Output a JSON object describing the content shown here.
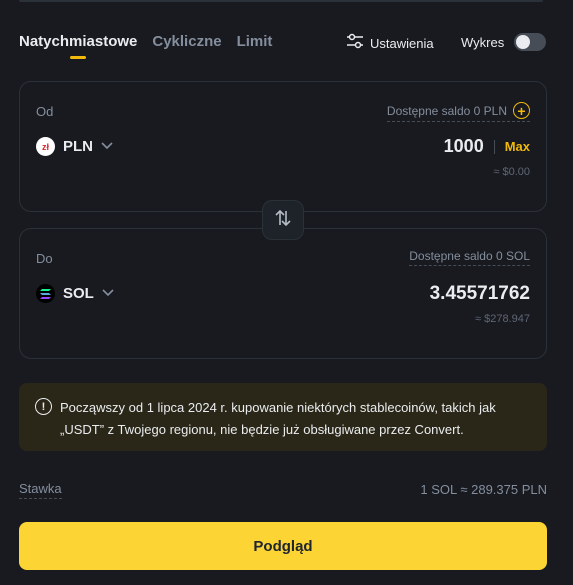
{
  "tabs": [
    {
      "label": "Natychmiastowe",
      "active": true
    },
    {
      "label": "Cykliczne",
      "active": false
    },
    {
      "label": "Limit",
      "active": false
    }
  ],
  "settings_label": "Ustawienia",
  "chart_toggle": {
    "label": "Wykres",
    "on": false
  },
  "from": {
    "label": "Od",
    "balance": "Dostępne saldo 0 PLN",
    "coin": "PLN",
    "coin_glyph": "zł",
    "amount": "1000",
    "max_label": "Max",
    "approx": "≈ $0.00"
  },
  "to": {
    "label": "Do",
    "balance": "Dostępne saldo 0 SOL",
    "coin": "SOL",
    "amount": "3.45571762",
    "approx": "≈ $278.947"
  },
  "notice": "Począwszy od 1 lipca 2024 r. kupowanie niektórych stablecoinów, takich jak „USDT” z Twojego regionu, nie będzie już obsługiwane przez Convert.",
  "rate": {
    "label": "Stawka",
    "value": "1 SOL ≈ 289.375 PLN"
  },
  "preview_label": "Podgląd",
  "colors": {
    "accent": "#f0b90b",
    "button": "#fcd535",
    "background": "#181a20"
  },
  "icons": [
    "settings-sliders-icon",
    "plus-circle-icon",
    "chevron-down-icon",
    "swap-arrows-icon",
    "info-icon",
    "pln-coin-icon",
    "sol-coin-icon"
  ]
}
